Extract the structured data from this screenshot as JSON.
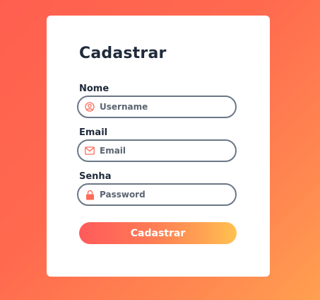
{
  "form": {
    "title": "Cadastrar",
    "fields": [
      {
        "label": "Nome",
        "placeholder": "Username",
        "value": "",
        "icon": "user-circle-icon"
      },
      {
        "label": "Email",
        "placeholder": "Email",
        "value": "",
        "icon": "envelope-icon"
      },
      {
        "label": "Senha",
        "placeholder": "Password",
        "value": "",
        "icon": "lock-icon"
      }
    ],
    "submit_label": "Cadastrar"
  },
  "colors": {
    "accent": "#ff6b5a",
    "gradient_start": "#ff5a5a",
    "gradient_end": "#ffc24f",
    "border": "#6b7786",
    "text": "#1f2a3a"
  }
}
